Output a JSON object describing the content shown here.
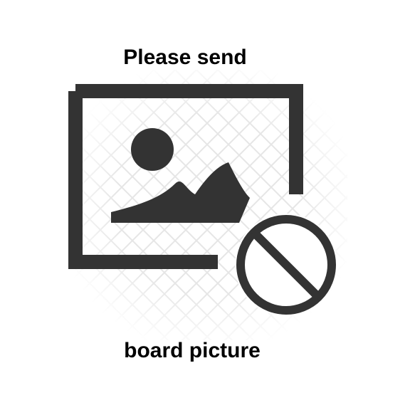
{
  "caption": {
    "top": "Please send",
    "bottom": "board picture"
  },
  "icon": {
    "name": "image-unavailable-icon",
    "color": "#333333",
    "pattern_color": "#e6e6e6"
  }
}
